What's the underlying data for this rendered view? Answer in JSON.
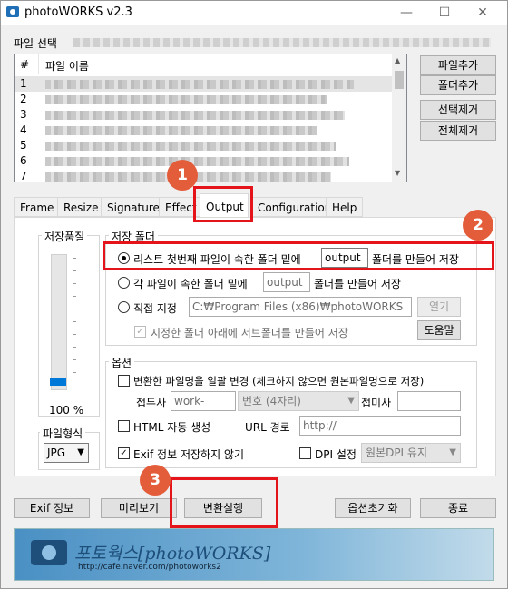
{
  "window": {
    "title": "photoWORKS v2.3",
    "min": "—",
    "max": "☐",
    "close": "✕"
  },
  "file_section": {
    "label": "파일 선택",
    "col_num": "#",
    "col_name": "파일 이름",
    "rows": [
      "1",
      "2",
      "3",
      "4",
      "5",
      "6",
      "7"
    ]
  },
  "file_buttons": {
    "add_file": "파일추가",
    "add_folder": "폴더추가",
    "remove_selected": "선택제거",
    "remove_all": "전체제거"
  },
  "tabs": [
    "Frame",
    "Resize",
    "Signature",
    "Effect",
    "Output",
    "Configuration",
    "Help"
  ],
  "quality": {
    "label": "저장품질",
    "value": "100 %"
  },
  "format": {
    "label": "파일형식",
    "value": "JPG"
  },
  "save_folder": {
    "label": "저장 폴더",
    "opt1_text": "리스트 첫번째 파일이 속한 폴더 밑에",
    "opt1_folder": "output",
    "opt1_suffix": "폴더를 만들어 저장",
    "opt2_text": "각 파일이 속한 폴더 밑에",
    "opt2_folder": "output",
    "opt2_suffix": "폴더를 만들어 저장",
    "opt3_text": "직접 지정",
    "opt3_path": "C:₩Program Files (x86)₩photoWORKS",
    "open_button": "열기",
    "subfolder_check": "지정한 폴더 아래에 서브폴더를 만들어 저장",
    "help_button": "도움말"
  },
  "options": {
    "label": "옵션",
    "rename_check": "변환한 파일명을 일괄 변경 (체크하지 않으면 원본파일명으로 저장)",
    "prefix_label": "접두사",
    "prefix_value": "work-",
    "number_value": "번호 (4자리)",
    "suffix_label": "접미사",
    "html_check": "HTML 자동 생성",
    "url_label": "URL 경로",
    "url_value": "http://",
    "exif_check": "Exif 정보 저장하지 않기",
    "dpi_check": "DPI 설정",
    "dpi_value": "원본DPI 유지"
  },
  "bottom_buttons": {
    "exif": "Exif 정보",
    "preview": "미리보기",
    "convert": "변환실행",
    "reset": "옵션초기화",
    "exit": "종료"
  },
  "banner": {
    "title": "포토웍스[photoWORKS]",
    "url": "http://cafe.naver.com/photoworks2"
  },
  "callouts": [
    "1",
    "2",
    "3"
  ],
  "colors": {
    "callout": "#e45d3b",
    "highlight": "#e5141b",
    "banner": "#4a90c4"
  }
}
